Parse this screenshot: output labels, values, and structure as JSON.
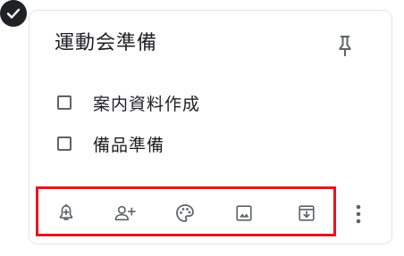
{
  "note": {
    "title": "運動会準備",
    "selected": true,
    "pinned": false,
    "checklist": [
      {
        "text": "案内資料作成",
        "checked": false
      },
      {
        "text": "備品準備",
        "checked": false
      }
    ]
  },
  "toolbar": {
    "buttons": [
      {
        "name": "remind-me",
        "icon": "bell-plus-icon"
      },
      {
        "name": "collaborator",
        "icon": "person-add-icon"
      },
      {
        "name": "background-options",
        "icon": "palette-icon"
      },
      {
        "name": "add-image",
        "icon": "image-icon"
      },
      {
        "name": "archive",
        "icon": "archive-icon"
      }
    ],
    "more_icon": "more-vert-icon"
  },
  "colors": {
    "text": "#202124",
    "icon": "#5f6368",
    "highlight_border": "#e8141c",
    "card_border": "#e3e3e3"
  }
}
